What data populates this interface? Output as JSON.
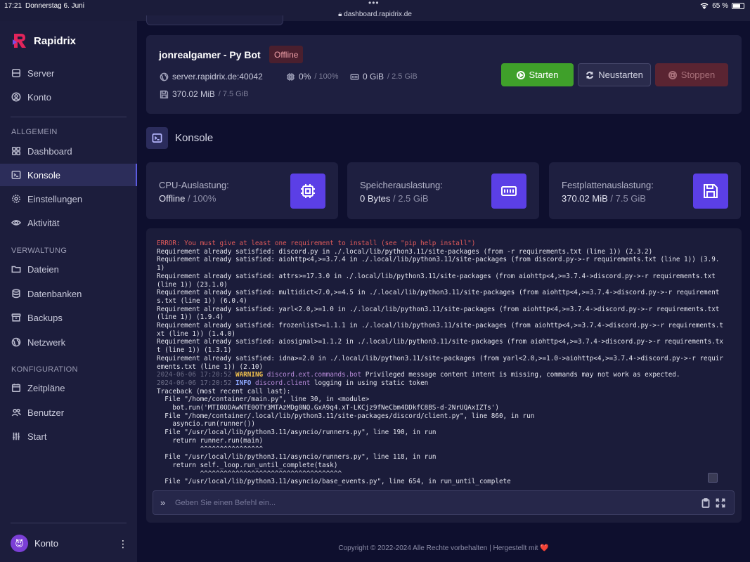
{
  "statusbar": {
    "time": "17:21",
    "date": "Donnerstag 6. Juni",
    "url": "dashboard.rapidrix.de",
    "battery": "65 %"
  },
  "brand": {
    "name": "Rapidrix"
  },
  "sidebar": {
    "top_items": [
      {
        "label": "Server",
        "icon": "server-icon"
      },
      {
        "label": "Konto",
        "icon": "user-circle-icon"
      }
    ],
    "sections": [
      {
        "title": "ALLGEMEIN",
        "items": [
          {
            "label": "Dashboard",
            "icon": "grid-icon"
          },
          {
            "label": "Konsole",
            "icon": "terminal-icon",
            "active": true
          },
          {
            "label": "Einstellungen",
            "icon": "gear-icon"
          },
          {
            "label": "Aktivität",
            "icon": "eye-icon"
          }
        ]
      },
      {
        "title": "VERWALTUNG",
        "items": [
          {
            "label": "Dateien",
            "icon": "folder-icon"
          },
          {
            "label": "Datenbanken",
            "icon": "database-icon"
          },
          {
            "label": "Backups",
            "icon": "archive-icon"
          },
          {
            "label": "Netzwerk",
            "icon": "globe-icon"
          }
        ]
      },
      {
        "title": "KONFIGURATION",
        "items": [
          {
            "label": "Zeitpläne",
            "icon": "calendar-icon"
          },
          {
            "label": "Benutzer",
            "icon": "users-icon"
          },
          {
            "label": "Start",
            "icon": "sliders-icon"
          }
        ]
      }
    ],
    "account_label": "Konto"
  },
  "server": {
    "name": "jonrealgamer - Py Bot",
    "status": "Offline",
    "address": "server.rapidrix.de:40042",
    "cpu": "0%",
    "cpu_limit": "/ 100%",
    "memory": "0 GiB",
    "memory_limit": "/ 2.5 GiB",
    "disk": "370.02 MiB",
    "disk_limit": "/ 7.5 GiB",
    "buttons": {
      "start": "Starten",
      "restart": "Neustarten",
      "stop": "Stoppen"
    }
  },
  "console_title": "Konsole",
  "metrics": [
    {
      "label": "CPU-Auslastung:",
      "value": "Offline",
      "limit": "/ 100%",
      "icon": "cpu-icon"
    },
    {
      "label": "Speicherauslastung:",
      "value": "0 Bytes",
      "limit": "/ 2.5 GiB",
      "icon": "memory-icon"
    },
    {
      "label": "Festplattenauslastung:",
      "value": "370.02 MiB",
      "limit": "/ 7.5 GiB",
      "icon": "floppy-disk-icon"
    }
  ],
  "console_lines": [
    {
      "type": "error",
      "text": "ERROR: You must give at least one requirement to install (see \"pip help install\")"
    },
    {
      "type": "plain",
      "text": "Requirement already satisfied: discord.py in ./.local/lib/python3.11/site-packages (from -r requirements.txt (line 1)) (2.3.2)"
    },
    {
      "type": "plain",
      "text": "Requirement already satisfied: aiohttp<4,>=3.7.4 in ./.local/lib/python3.11/site-packages (from discord.py->-r requirements.txt (line 1)) (3.9.1)"
    },
    {
      "type": "plain",
      "text": "Requirement already satisfied: attrs>=17.3.0 in ./.local/lib/python3.11/site-packages (from aiohttp<4,>=3.7.4->discord.py->-r requirements.txt (line 1)) (23.1.0)"
    },
    {
      "type": "plain",
      "text": "Requirement already satisfied: multidict<7.0,>=4.5 in ./.local/lib/python3.11/site-packages (from aiohttp<4,>=3.7.4->discord.py->-r requirements.txt (line 1)) (6.0.4)"
    },
    {
      "type": "plain",
      "text": "Requirement already satisfied: yarl<2.0,>=1.0 in ./.local/lib/python3.11/site-packages (from aiohttp<4,>=3.7.4->discord.py->-r requirements.txt (line 1)) (1.9.4)"
    },
    {
      "type": "plain",
      "text": "Requirement already satisfied: frozenlist>=1.1.1 in ./.local/lib/python3.11/site-packages (from aiohttp<4,>=3.7.4->discord.py->-r requirements.txt (line 1)) (1.4.0)"
    },
    {
      "type": "plain",
      "text": "Requirement already satisfied: aiosignal>=1.1.2 in ./.local/lib/python3.11/site-packages (from aiohttp<4,>=3.7.4->discord.py->-r requirements.txt (line 1)) (1.3.1)"
    },
    {
      "type": "plain",
      "text": "Requirement already satisfied: idna>=2.0 in ./.local/lib/python3.11/site-packages (from yarl<2.0,>=1.0->aiohttp<4,>=3.7.4->discord.py->-r requirements.txt (line 1)) (2.10)"
    },
    {
      "type": "log",
      "ts": "2024-06-06 17:20:52",
      "level": "WARNING",
      "source": "discord.ext.commands.bot",
      "text": "Privileged message content intent is missing, commands may not work as expected."
    },
    {
      "type": "log",
      "ts": "2024-06-06 17:20:52",
      "level": "INFO",
      "source": "discord.client",
      "text": "logging in using static token"
    },
    {
      "type": "plain",
      "text": "Traceback (most recent call last):"
    },
    {
      "type": "plain",
      "text": "  File \"/home/container/main.py\", line 30, in <module>"
    },
    {
      "type": "plain",
      "text": "    bot.run('MTI0ODAwNTE0OTY3MTAzMDg0NQ.GxA9q4.xT-LKCjz9fNeCbm4DDkfC8BS-d-2NrUQAxIZTs')"
    },
    {
      "type": "plain",
      "text": "  File \"/home/container/.local/lib/python3.11/site-packages/discord/client.py\", line 860, in run"
    },
    {
      "type": "plain",
      "text": "    asyncio.run(runner())"
    },
    {
      "type": "plain",
      "text": "  File \"/usr/local/lib/python3.11/asyncio/runners.py\", line 190, in run"
    },
    {
      "type": "plain",
      "text": "    return runner.run(main)"
    },
    {
      "type": "plain",
      "text": "           ^^^^^^^^^^^^^^^^"
    },
    {
      "type": "plain",
      "text": "  File \"/usr/local/lib/python3.11/asyncio/runners.py\", line 118, in run"
    },
    {
      "type": "plain",
      "text": "    return self._loop.run_until_complete(task)"
    },
    {
      "type": "plain",
      "text": "           ^^^^^^^^^^^^^^^^^^^^^^^^^^^^^^^^^^^^"
    },
    {
      "type": "plain",
      "text": "  File \"/usr/local/lib/python3.11/asyncio/base_events.py\", line 654, in run_until_complete"
    }
  ],
  "command_input": {
    "placeholder": "Geben Sie einen Befehl ein...",
    "value": ""
  },
  "footer": {
    "text": "Copyright © 2022-2024 Alle Rechte vorbehalten | Hergestellt mit",
    "heart": "❤️"
  }
}
